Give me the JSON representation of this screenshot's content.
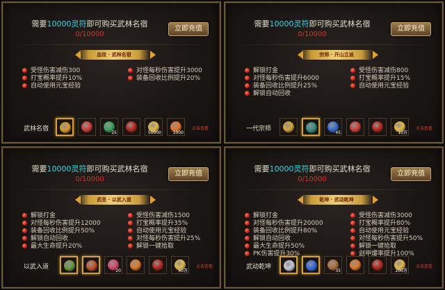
{
  "panels": [
    {
      "need_prefix": "需要",
      "need_amount": "10000灵符",
      "need_suffix": "即可购买武林名宿",
      "count": "0/10000",
      "button": "立即充值",
      "title": "血玫 · 武林名宿",
      "perks_left": [
        "受怪伤害减伤300",
        "打宝概率提升10%",
        "自动使用元宝经验"
      ],
      "perks_right": [
        "对怪每秒伤害提升3000",
        "装备回收比例提升20%"
      ],
      "rank": "武林名宿",
      "items": [
        {
          "icon": "golden-warrior-icon",
          "qty": "",
          "selected": true,
          "color": "#d79a2e"
        },
        {
          "icon": "red-gift-icon",
          "qty": "",
          "selected": false,
          "color": "#c94338"
        },
        {
          "icon": "green-orb-icon",
          "qty": "25",
          "selected": false,
          "color": "#3aa35a"
        },
        {
          "icon": "red-sword-icon",
          "qty": "",
          "selected": false,
          "color": "#b52b22"
        },
        {
          "icon": "gold-ingot-icon",
          "qty": "50000",
          "selected": false,
          "color": "#e0b84a"
        },
        {
          "icon": "orange-gourd-icon",
          "qty": "1000",
          "selected": false,
          "color": "#e0752a"
        }
      ],
      "detail": "点击查看"
    },
    {
      "need_prefix": "需要",
      "need_amount": "10000灵符",
      "need_suffix": "即可购买武林名宿",
      "count": "0/10000",
      "button": "立即充值",
      "title": "宗师 · 开山立派",
      "perks_left": [
        "解锁打金",
        "对怪每秒伤害提升6000",
        "装备回收比例提升25%",
        "解锁自动回收"
      ],
      "perks_right": [
        "受怪伤害减伤800",
        "打宝概率提升15%",
        "自动使用元宝经验"
      ],
      "rank": "一代宗师",
      "items": [
        {
          "icon": "gold-boat-icon",
          "qty": "",
          "selected": false,
          "color": "#d4a43a"
        },
        {
          "icon": "dark-mask-icon",
          "qty": "",
          "selected": true,
          "color": "#3b8a84"
        },
        {
          "icon": "blue-orb-icon",
          "qty": "45",
          "selected": false,
          "color": "#3a6fd0"
        },
        {
          "icon": "red-gift-icon",
          "qty": "",
          "selected": false,
          "color": "#c94338"
        },
        {
          "icon": "red-sword-icon",
          "qty": "",
          "selected": false,
          "color": "#b52b22"
        },
        {
          "icon": "gold-ingot-icon",
          "qty": "10万",
          "selected": false,
          "color": "#e0b84a"
        }
      ],
      "detail": "点击查看"
    },
    {
      "need_prefix": "需要",
      "need_amount": "10000灵符",
      "need_suffix": "即可购买武林名宿",
      "count": "0/10000",
      "button": "立即充值",
      "title": "武圣 · 以武入道",
      "perks_left": [
        "解锁打金",
        "对怪每秒伤害提升12000",
        "装备回收比例提升50%",
        "解锁自动回收",
        "最大生命提升20%"
      ],
      "perks_right": [
        "受怪伤害减伤1500",
        "打宝概率提升35%",
        "自动使用元宝经验",
        "对怪每秒伤害提升25%",
        "解锁一键拾取"
      ],
      "rank": "以武入道",
      "items": [
        {
          "icon": "jade-medal-icon",
          "qty": "",
          "selected": true,
          "color": "#6a9a40"
        },
        {
          "icon": "fire-ring-icon",
          "qty": "",
          "selected": true,
          "color": "#c2542a"
        },
        {
          "icon": "pink-orb-icon",
          "qty": "20",
          "selected": false,
          "color": "#d44a6a"
        },
        {
          "icon": "orange-box-icon",
          "qty": "",
          "selected": false,
          "color": "#e07a2a"
        },
        {
          "icon": "red-sword-icon",
          "qty": "",
          "selected": false,
          "color": "#b52b22"
        },
        {
          "icon": "gold-ingot-icon",
          "qty": "60万",
          "selected": false,
          "color": "#e0b84a"
        }
      ],
      "detail": "点击查看"
    },
    {
      "need_prefix": "需要",
      "need_amount": "10000灵符",
      "need_suffix": "即可购买武林名宿",
      "count": "0/10000",
      "button": "立即充值",
      "title": "乾坤 · 武动乾坤",
      "perks_left": [
        "解锁打金",
        "对怪每秒伤害提升20000",
        "装备回收比例提升80%",
        "解锁自动回收",
        "最大生命提升50%",
        "PK伤害提升30%"
      ],
      "perks_right": [
        "受怪伤害减伤3000",
        "打宝概率提升80%",
        "自动使用元宝经验",
        "对怪每秒伤害提升50%",
        "解锁一键拾取",
        "刽甲爆率提升100%"
      ],
      "rank": "武动乾坤",
      "items": [
        {
          "icon": "silver-blade-icon",
          "qty": "",
          "selected": true,
          "color": "#c8c8d8"
        },
        {
          "icon": "blue-lightning-icon",
          "qty": "",
          "selected": true,
          "color": "#3a6ae0"
        },
        {
          "icon": "bronze-orb-icon",
          "qty": "35",
          "selected": false,
          "color": "#b07040"
        },
        {
          "icon": "orange-box-icon",
          "qty": "",
          "selected": false,
          "color": "#e07a2a"
        },
        {
          "icon": "red-sword-icon",
          "qty": "",
          "selected": false,
          "color": "#b52b22"
        },
        {
          "icon": "gold-ingot-icon",
          "qty": "200万",
          "selected": false,
          "color": "#e0b84a"
        }
      ],
      "detail": "点击查看"
    }
  ]
}
